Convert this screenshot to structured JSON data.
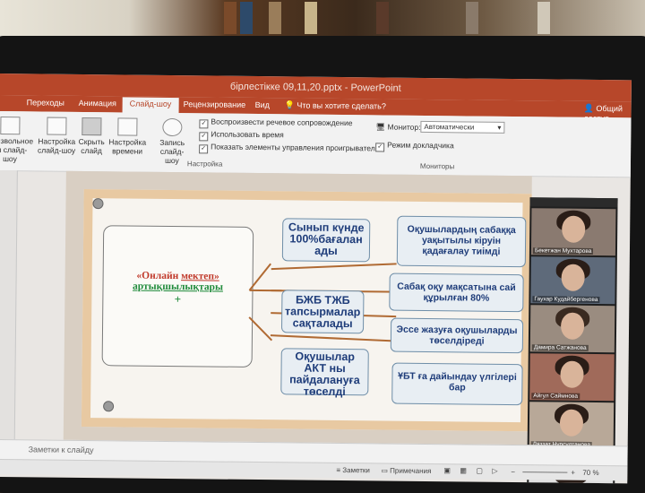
{
  "window": {
    "title": "бірлестікке 09,11,20.pptx - PowerPoint"
  },
  "tabs": [
    {
      "label": "Переходы"
    },
    {
      "label": "Анимация"
    },
    {
      "label": "Слайд-шоу"
    },
    {
      "label": "Рецензирование"
    },
    {
      "label": "Вид"
    }
  ],
  "tell_me": "Что вы хотите сделать?",
  "share": "Общий доступ",
  "ribbon": {
    "buttons": [
      {
        "line1": "оизвольное",
        "line2": "ан слайд-шоу"
      },
      {
        "line1": "Настройка",
        "line2": "слайд-шоу"
      },
      {
        "line1": "Скрыть",
        "line2": "слайд"
      },
      {
        "line1": "Настройка",
        "line2": "времени"
      },
      {
        "line1": "Запись слайд-",
        "line2": "шоу"
      }
    ],
    "checkboxes": [
      {
        "label": "Воспроизвести речевое сопровождение"
      },
      {
        "label": "Использовать время"
      },
      {
        "label": "Показать элементы управления проигрывателем"
      }
    ],
    "group_setup": "Настройка",
    "monitor_label": "Монитор:",
    "monitor_value": "Автоматически",
    "presenter_label": "Режим докладчика",
    "group_monitors": "Мониторы"
  },
  "slide": {
    "title_word1": "«Онлайн",
    "title_word2": "мектеп»",
    "title_line2": "артықшылықтары",
    "plus": "+",
    "left_boxes": [
      {
        "line1": "Сынып күнде",
        "line2": "100%бағалан",
        "line3": "ады"
      },
      {
        "line1": "БЖБ ТЖБ",
        "line2": "тапсырмалар",
        "line3": "сақталады"
      },
      {
        "line1": "Оқушылар",
        "line2": "АКТ ны",
        "line3": "пайдалануға",
        "line4": "төселді"
      }
    ],
    "right_boxes": [
      {
        "line1": "Оқушылардың сабаққа",
        "line2": "уақытылы кіруін",
        "line3": "қадағалау тиімді"
      },
      {
        "line1": "Сабақ оқу мақсатына сай",
        "line2": "құрылған 80%"
      },
      {
        "line1": "Эссе жазуға оқушыларды",
        "line2": "төселдіреді"
      },
      {
        "line1": "ҰБТ ға дайындау үлгілері",
        "line2": "бар"
      }
    ]
  },
  "participants": [
    {
      "name": "Бекетжан Мухтарова"
    },
    {
      "name": "Гаухар Кудайбергенова"
    },
    {
      "name": "Дамира Сатжанова"
    },
    {
      "name": "Айгул Саймнова"
    },
    {
      "name": "Ляззат Нурсултанова"
    },
    {
      "name": ""
    }
  ],
  "notes": "Заметки к слайду",
  "status": {
    "notes_btn": "Заметки",
    "comments_btn": "Примечания",
    "zoom": "70 %"
  },
  "colors": {
    "accent": "#b7472a",
    "box_text": "#1f3d7a",
    "connector": "#b06a33"
  }
}
